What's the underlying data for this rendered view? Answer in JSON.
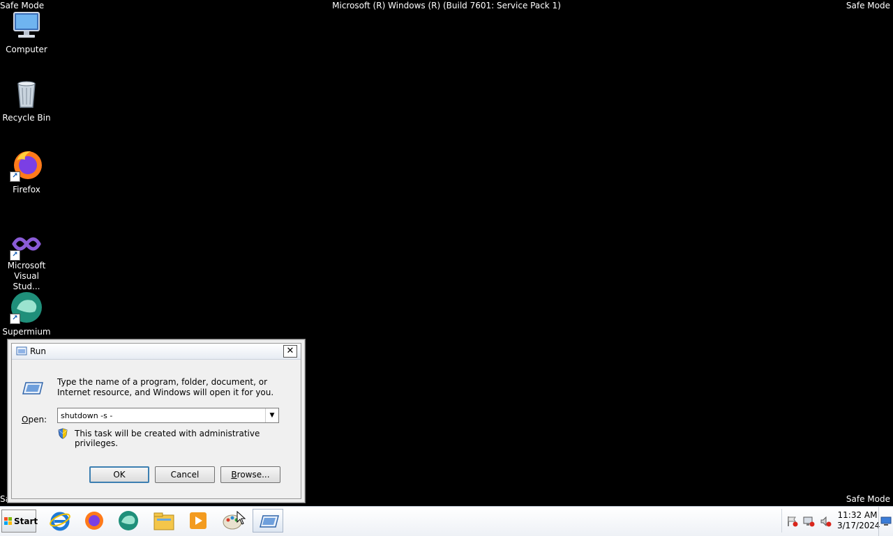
{
  "overlay": {
    "top_left": "Safe Mode",
    "top_center": "Microsoft (R) Windows (R) (Build 7601: Service Pack 1)",
    "top_right": "Safe Mode",
    "bottom_left": "Safe Mode",
    "bottom_right": "Safe Mode"
  },
  "desktop": {
    "icons": [
      {
        "label": "Computer"
      },
      {
        "label": "Recycle Bin"
      },
      {
        "label": "Firefox"
      },
      {
        "label_line1": "Microsoft",
        "label_line2": "Visual Stud..."
      },
      {
        "label": "Supermium"
      }
    ]
  },
  "run_dialog": {
    "title": "Run",
    "close_glyph": "✕",
    "description": "Type the name of a program, folder, document, or Internet resource, and Windows will open it for you.",
    "open_label_prefix": "O",
    "open_label_rest": "pen:",
    "open_value": "shutdown -s -",
    "admin_note": "This task will be created with administrative privileges.",
    "ok_label": "OK",
    "cancel_label": "Cancel",
    "browse_prefix": "B",
    "browse_rest": "rowse..."
  },
  "taskbar": {
    "start_label": "Start",
    "pinned": [
      "internet-explorer-icon",
      "firefox-icon",
      "supermium-icon",
      "file-explorer-icon",
      "media-player-icon",
      "paint-icon",
      "run-icon"
    ],
    "clock_time": "11:32 AM",
    "clock_date": "3/17/2024"
  }
}
